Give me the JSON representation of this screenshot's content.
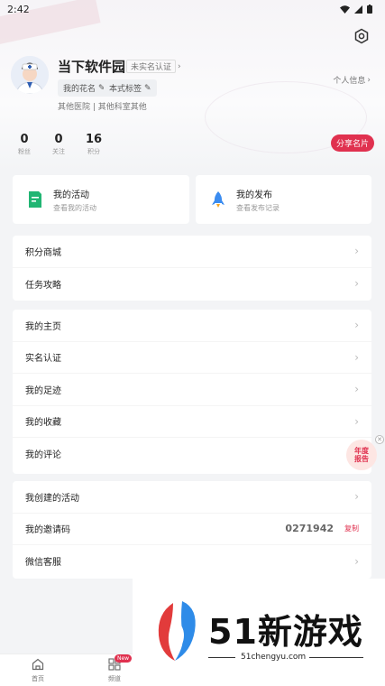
{
  "status_bar": {
    "time": "2:42"
  },
  "profile": {
    "name": "当下软件园",
    "verify_label": "未实名认证",
    "tags": [
      "我的花名",
      "本式标签"
    ],
    "hospital": "其他医院 | 其他科室其他",
    "personal_info_label": "个人信息",
    "stats": [
      {
        "value": "0",
        "label": "粉丝"
      },
      {
        "value": "0",
        "label": "关注"
      },
      {
        "value": "16",
        "label": "积分"
      }
    ],
    "share_button": "分享名片"
  },
  "cards": [
    {
      "title": "我的活动",
      "subtitle": "查看我的活动",
      "icon": "activity-doc-icon"
    },
    {
      "title": "我的发布",
      "subtitle": "查看发布记录",
      "icon": "rocket-icon"
    }
  ],
  "menu_group_1": [
    {
      "label": "积分商城"
    },
    {
      "label": "任务攻略"
    }
  ],
  "menu_group_2": [
    {
      "label": "我的主页"
    },
    {
      "label": "实名认证"
    },
    {
      "label": "我的足迹"
    },
    {
      "label": "我的收藏"
    },
    {
      "label": "我的评论"
    }
  ],
  "menu_group_3": [
    {
      "label": "我创建的活动"
    },
    {
      "label": "我的邀请码",
      "value": "0271942",
      "action": "复制"
    },
    {
      "label": "微信客服"
    }
  ],
  "floating_badge": {
    "line1": "年度",
    "line2": "报告"
  },
  "tabbar": {
    "tabs": [
      {
        "label": "首页",
        "icon": "home-icon"
      },
      {
        "label": "频道",
        "icon": "channel-grid-icon",
        "badge": "New"
      }
    ]
  },
  "watermark": {
    "text": "51新游戏",
    "url": "51chengyu.com"
  },
  "colors": {
    "accent": "#e0314f",
    "background": "#f3f4f6",
    "card": "#ffffff"
  }
}
